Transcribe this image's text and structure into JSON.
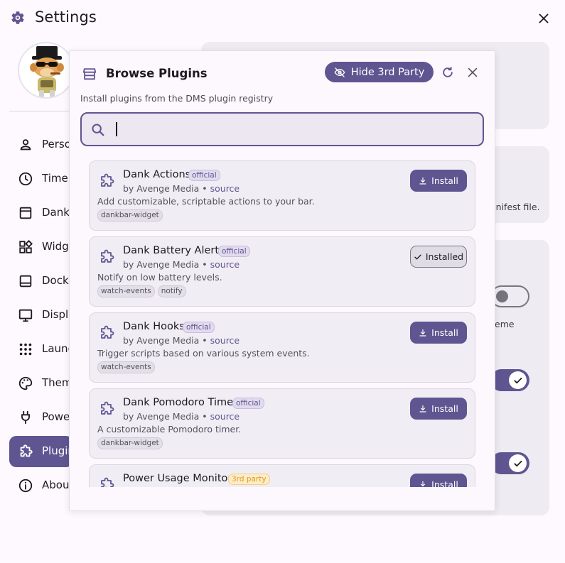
{
  "colors": {
    "accent": "#5f5591",
    "official_badge": "#5f5591",
    "third_party_badge": "#e09a1e",
    "surface": "#fdf9fe"
  },
  "settings": {
    "title": "Settings",
    "title_icon": "gear-icon",
    "close_icon": "close-icon",
    "nav": [
      {
        "label": "Perso",
        "icon": "person-icon",
        "active": false
      },
      {
        "label": "Time a",
        "icon": "clock-icon",
        "active": false
      },
      {
        "label": "Dank B",
        "icon": "panel-icon",
        "active": false
      },
      {
        "label": "Widge",
        "icon": "widgets-icon",
        "active": false
      },
      {
        "label": "Dock",
        "icon": "dock-icon",
        "active": false
      },
      {
        "label": "Displa",
        "icon": "monitor-icon",
        "active": false
      },
      {
        "label": "Launc",
        "icon": "apps-grid-icon",
        "active": false
      },
      {
        "label": "Theme",
        "icon": "palette-icon",
        "active": false
      },
      {
        "label": "Power",
        "icon": "power-plug-icon",
        "active": false
      },
      {
        "label": "Plugin",
        "icon": "puzzle-icon",
        "active": true
      },
      {
        "label": "About",
        "icon": "info-icon",
        "active": false
      }
    ],
    "background_fragments": {
      "manifest": "anifest file.",
      "theme": "eme"
    }
  },
  "modal": {
    "title": "Browse Plugins",
    "title_icon": "store-icon",
    "hide_button_label": "Hide 3rd Party",
    "hide_button_icon": "eye-off-icon",
    "refresh_icon": "refresh-icon",
    "close_icon": "close-icon",
    "subtitle": "Install plugins from the DMS plugin registry",
    "search": {
      "value": "",
      "placeholder": ""
    }
  },
  "plugins": [
    {
      "name": "Dank Actions",
      "badge": "official",
      "author": "by Avenge Media",
      "separator": " • ",
      "source": "source",
      "description": "Add customizable, scriptable actions to your bar.",
      "tags": [
        "dankbar-widget"
      ],
      "status": "install",
      "button_label": "Install"
    },
    {
      "name": "Dank Battery Alerts",
      "badge": "official",
      "author": "by Avenge Media",
      "separator": " • ",
      "source": "source",
      "description": "Notify on low battery levels.",
      "tags": [
        "watch-events",
        "notify"
      ],
      "status": "installed",
      "button_label": "Installed"
    },
    {
      "name": "Dank Hooks",
      "badge": "official",
      "author": "by Avenge Media",
      "separator": " • ",
      "source": "source",
      "description": "Trigger scripts based on various system events.",
      "tags": [
        "watch-events"
      ],
      "status": "install",
      "button_label": "Install"
    },
    {
      "name": "Dank Pomodoro Timer",
      "badge": "official",
      "author": "by Avenge Media",
      "separator": " • ",
      "source": "source",
      "description": "A customizable Pomodoro timer.",
      "tags": [
        "dankbar-widget"
      ],
      "status": "install",
      "button_label": "Install"
    },
    {
      "name": "Power Usage Monitor",
      "badge": "3rd party",
      "author": "",
      "separator": "",
      "source": "",
      "description": "",
      "tags": [],
      "status": "install",
      "button_label": "Install"
    }
  ]
}
